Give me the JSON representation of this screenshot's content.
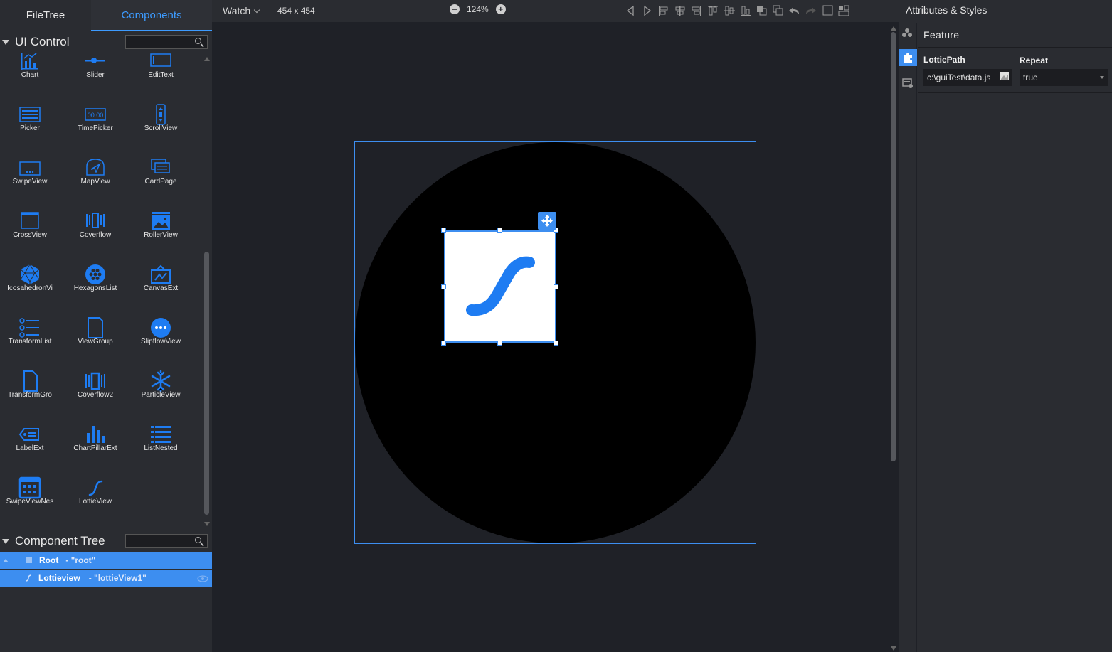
{
  "tabs": {
    "filetree": "FileTree",
    "components": "Components"
  },
  "ui_control": {
    "title": "UI Control",
    "search_placeholder": "",
    "items": [
      {
        "label": "Chart",
        "icon": "chart-icon"
      },
      {
        "label": "Slider",
        "icon": "slider-icon"
      },
      {
        "label": "EditText",
        "icon": "edittext-icon"
      },
      {
        "label": "Picker",
        "icon": "picker-icon"
      },
      {
        "label": "TimePicker",
        "icon": "timepicker-icon"
      },
      {
        "label": "ScrollView",
        "icon": "scrollview-icon"
      },
      {
        "label": "SwipeView",
        "icon": "swipeview-icon"
      },
      {
        "label": "MapView",
        "icon": "mapview-icon"
      },
      {
        "label": "CardPage",
        "icon": "cardpage-icon"
      },
      {
        "label": "CrossView",
        "icon": "crossview-icon"
      },
      {
        "label": "Coverflow",
        "icon": "coverflow-icon"
      },
      {
        "label": "RollerView",
        "icon": "rollerview-icon"
      },
      {
        "label": "IcosahedronVi",
        "icon": "icosahedron-icon"
      },
      {
        "label": "HexagonsList",
        "icon": "hexagonslist-icon"
      },
      {
        "label": "CanvasExt",
        "icon": "canvasext-icon"
      },
      {
        "label": "TransformList",
        "icon": "transformlist-icon"
      },
      {
        "label": "ViewGroup",
        "icon": "viewgroup-icon"
      },
      {
        "label": "SlipflowView",
        "icon": "slipflowview-icon"
      },
      {
        "label": "TransformGro",
        "icon": "transformgroup-icon"
      },
      {
        "label": "Coverflow2",
        "icon": "coverflow2-icon"
      },
      {
        "label": "ParticleView",
        "icon": "particleview-icon"
      },
      {
        "label": "LabelExt",
        "icon": "labelext-icon"
      },
      {
        "label": "ChartPillarExt",
        "icon": "chartpillarext-icon"
      },
      {
        "label": "ListNested",
        "icon": "listnested-icon"
      },
      {
        "label": "SwipeViewNes",
        "icon": "swipeviewnested-icon"
      },
      {
        "label": "LottieView",
        "icon": "lottieview-icon"
      }
    ]
  },
  "component_tree": {
    "title": "Component Tree",
    "rows": [
      {
        "name": "Root",
        "id": "- \"root\""
      },
      {
        "name": "Lottieview",
        "id": "- \"lottieView1\""
      }
    ]
  },
  "toolbar": {
    "device": "Watch",
    "resolution": "454 x 454",
    "zoom": "124%",
    "zoom_out": "−",
    "zoom_in": "+"
  },
  "right_panel": {
    "title": "Attributes & Styles",
    "section": "Feature",
    "fields": {
      "lottie_path_label": "LottiePath",
      "lottie_path_value": "c:\\guiTest\\data.js",
      "repeat_label": "Repeat",
      "repeat_value": "true"
    }
  },
  "colors": {
    "accent": "#3d8ef0",
    "component_blue": "#1e7cf2"
  }
}
